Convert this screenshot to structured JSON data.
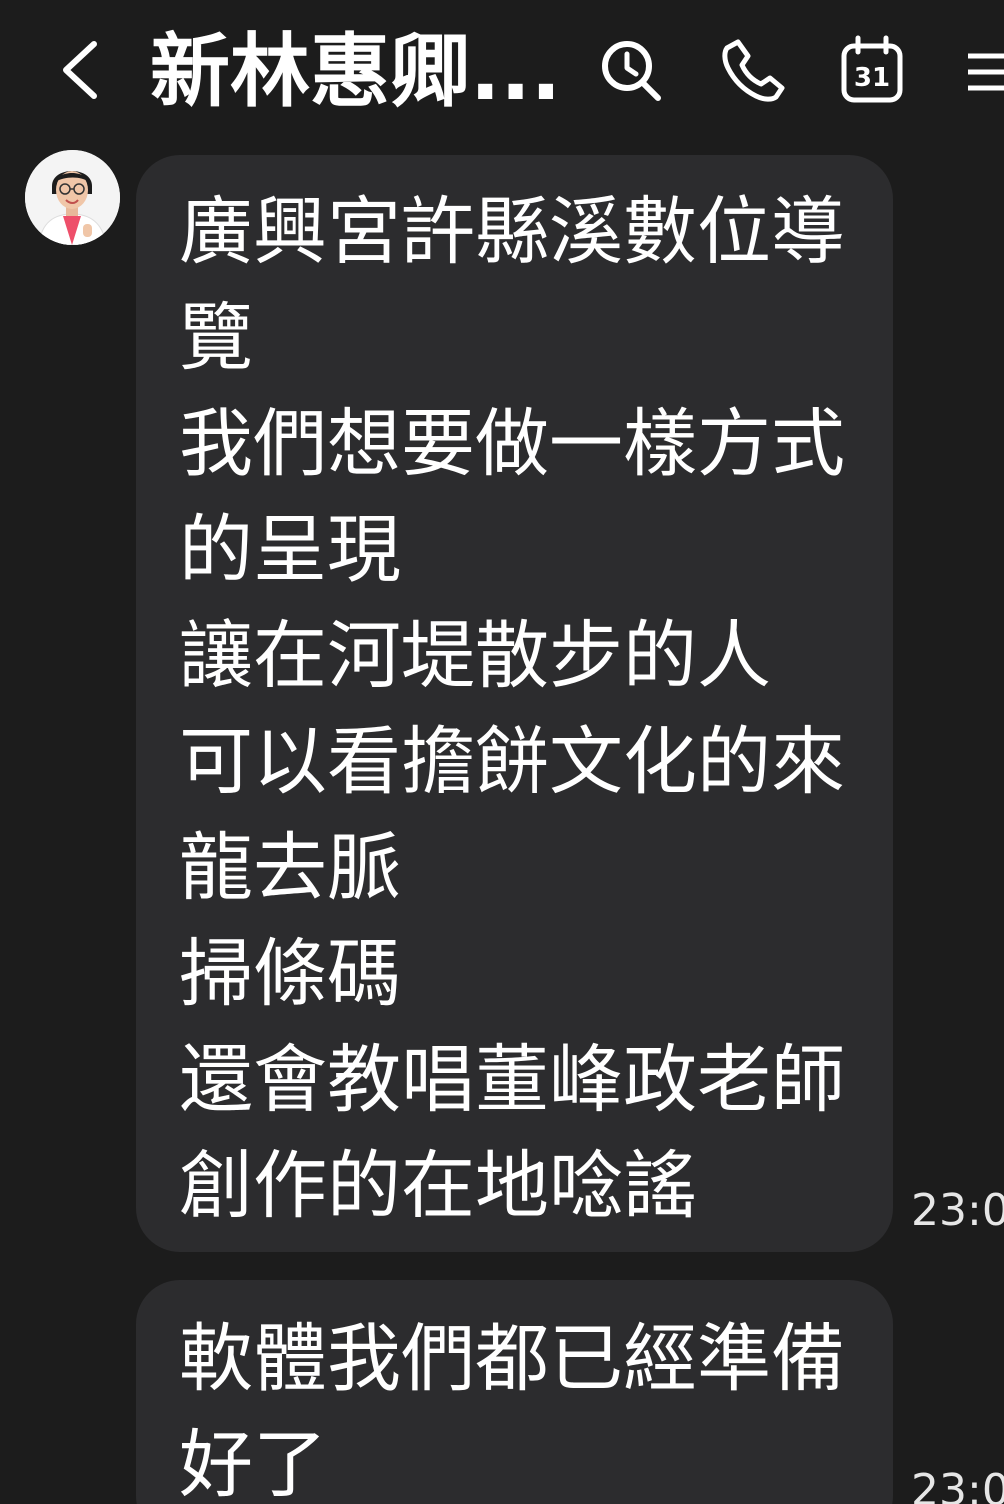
{
  "header": {
    "title": "新林惠卿...",
    "back_icon": "chevron-left-icon",
    "search_icon": "search-icon",
    "call_icon": "phone-icon",
    "calendar_icon": "calendar-icon",
    "calendar_day": "31",
    "menu_icon": "menu-icon"
  },
  "messages": [
    {
      "lines": [
        "廣興宮許縣溪數位導",
        "覽",
        "我們想要做一樣方式",
        "的呈現",
        "讓在河堤散步的人",
        "可以看擔餅文化的來",
        "龍去脈",
        "掃條碼",
        "還會教唱董峰政老師",
        "創作的在地唸謠"
      ],
      "time": "23:0"
    },
    {
      "lines": [
        "軟體我們都已經準備",
        "好了"
      ],
      "time": "23:0"
    }
  ],
  "colors": {
    "background": "#1c1c1c",
    "bubble": "#2c2c2e",
    "text": "#ffffff",
    "avatar_accent": "#ee4f6a"
  }
}
